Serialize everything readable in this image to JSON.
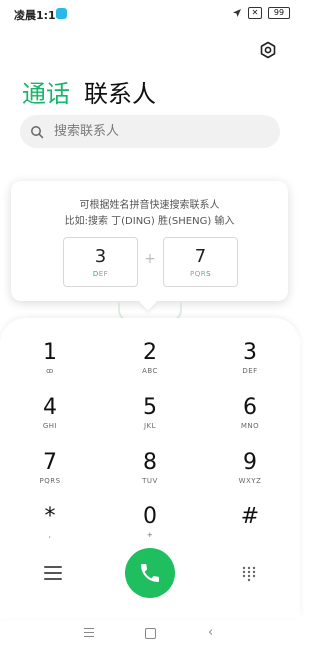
{
  "status": {
    "time": "凌晨1:14",
    "battery": "99"
  },
  "tabs": {
    "calls": "通话",
    "contacts": "联系人"
  },
  "search": {
    "placeholder": "搜索联系人"
  },
  "hint": {
    "line1": "可根据姓名拼音快速搜索联系人",
    "line2": "比如:搜索 丁(DING) 胜(SHENG) 输入",
    "examples": [
      {
        "num": "3",
        "letters_pre": "",
        "letters_hl": "D",
        "letters_post": "EF"
      },
      {
        "num": "7",
        "letters_pre": "PQR",
        "letters_hl": "S",
        "letters_post": ""
      }
    ],
    "plus": "+"
  },
  "keys": [
    {
      "d": "1",
      "l": "ꝏ"
    },
    {
      "d": "2",
      "l": "ABC"
    },
    {
      "d": "3",
      "l": "DEF"
    },
    {
      "d": "4",
      "l": "GHI"
    },
    {
      "d": "5",
      "l": "JKL"
    },
    {
      "d": "6",
      "l": "MNO"
    },
    {
      "d": "7",
      "l": "PQRS"
    },
    {
      "d": "8",
      "l": "TUV"
    },
    {
      "d": "9",
      "l": "WXYZ"
    },
    {
      "d": "*",
      "l": ","
    },
    {
      "d": "0",
      "l": "+"
    },
    {
      "d": "#",
      "l": ""
    }
  ],
  "colors": {
    "accent": "#19b56a",
    "call": "#1fbf60"
  },
  "icons": {
    "settings": "gear-icon",
    "search": "search-icon",
    "call": "phone-icon",
    "menu": "menu-icon",
    "dialpad": "dialpad-icon"
  }
}
